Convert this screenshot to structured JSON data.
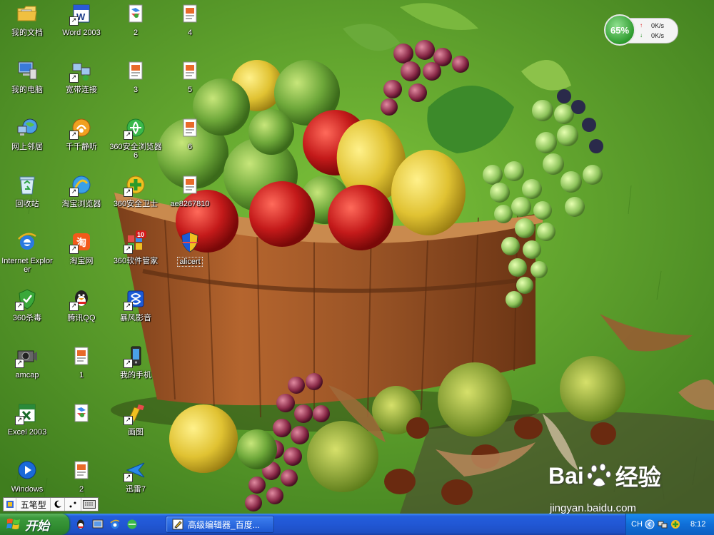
{
  "desktop": {
    "icons": [
      {
        "label": "我的文档"
      },
      {
        "label": "Word 2003"
      },
      {
        "label": "2"
      },
      {
        "label": "4"
      },
      {
        "label": "我的电脑"
      },
      {
        "label": "宽带连接"
      },
      {
        "label": "3"
      },
      {
        "label": "5"
      },
      {
        "label": "网上邻居"
      },
      {
        "label": "千千静听"
      },
      {
        "label": "360安全浏览器6"
      },
      {
        "label": "6"
      },
      {
        "label": "回收站"
      },
      {
        "label": "淘宝浏览器"
      },
      {
        "label": "360安全卫士"
      },
      {
        "label": "ae8267810"
      },
      {
        "label": "Internet Explorer"
      },
      {
        "label": "淘宝网"
      },
      {
        "label": "360软件管家",
        "badge": "10"
      },
      {
        "label": "alicert"
      },
      {
        "label": "360杀毒"
      },
      {
        "label": "腾讯QQ"
      },
      {
        "label": "暴风影音"
      },
      {
        "label": "amcap"
      },
      {
        "label": "1"
      },
      {
        "label": "我的手机"
      },
      {
        "label": "Excel 2003"
      },
      {
        "label": ""
      },
      {
        "label": "画图"
      },
      {
        "label": "Windows"
      },
      {
        "label": "2"
      },
      {
        "label": "迅雷7"
      }
    ]
  },
  "netmeter": {
    "percent": "65%",
    "upload": "0K/s",
    "download": "0K/s"
  },
  "ime": {
    "mode": "五笔型"
  },
  "taskbar": {
    "start_label": "开始",
    "task": {
      "label": "高级编辑器_百度..."
    },
    "tray": {
      "lang": "CH",
      "clock": "8:12"
    }
  },
  "watermark": {
    "logo_text": "Bai",
    "logo_suffix": "经验",
    "url": "jingyan.baidu.com"
  },
  "colors": {
    "taskbar_blue": "#245edc",
    "start_green": "#3c9a3c",
    "tray_blue": "#0f6fd8",
    "net_green": "#2e9b2e"
  }
}
